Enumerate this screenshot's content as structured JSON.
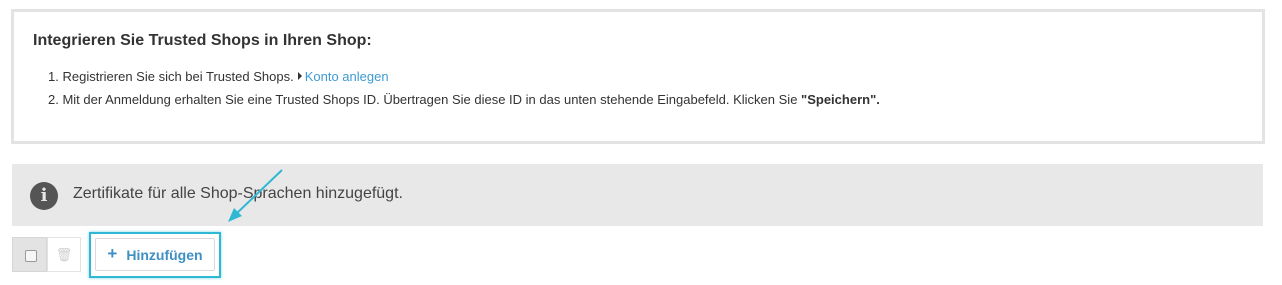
{
  "info": {
    "title": "Integrieren Sie Trusted Shops in Ihren Shop:",
    "step1_num": "1.",
    "step1_text": "Registrieren Sie sich bei Trusted Shops.",
    "step1_link": "Konto anlegen",
    "step2_num": "2.",
    "step2_text": "Mit der Anmeldung erhalten Sie eine Trusted Shops ID. Übertragen Sie diese ID in das unten stehende Eingabefeld. Klicken Sie",
    "step2_bold": "\"Speichern\"."
  },
  "alert": {
    "icon": "info-icon",
    "icon_glyph": "i",
    "text": "Zertifikate für alle Shop-Sprachen hinzugefügt."
  },
  "toolbar": {
    "select_all_icon": "checkbox",
    "delete_icon": "trash-icon",
    "delete_glyph": "🗑",
    "add_icon": "plus-icon",
    "add_glyph": "+",
    "add_label": "Hinzufügen"
  },
  "colors": {
    "link": "#3e9bd4",
    "annotation": "#2fb8d3",
    "alert_bg": "#e8e8e8"
  }
}
